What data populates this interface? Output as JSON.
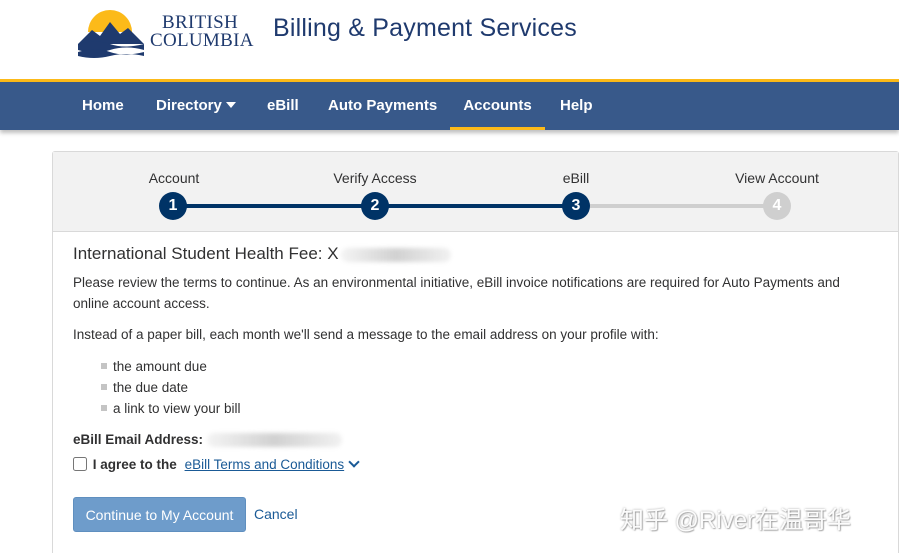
{
  "header": {
    "logo_line1": "BRITISH",
    "logo_line2": "COLUMBIA",
    "title": "Billing & Payment Services"
  },
  "nav": {
    "items": [
      {
        "label": "Home"
      },
      {
        "label": "Directory"
      },
      {
        "label": "eBill"
      },
      {
        "label": "Auto Payments"
      },
      {
        "label": "Accounts"
      },
      {
        "label": "Help"
      }
    ],
    "active": "Accounts"
  },
  "stepper": {
    "steps": [
      {
        "label": "Account",
        "number": "1",
        "state": "complete"
      },
      {
        "label": "Verify Access",
        "number": "2",
        "state": "complete"
      },
      {
        "label": "eBill",
        "number": "3",
        "state": "current"
      },
      {
        "label": "View Account",
        "number": "4",
        "state": "upcoming"
      }
    ]
  },
  "content": {
    "fee_title": "International Student Health Fee: X",
    "intro": "Please review the terms to continue. As an environmental initiative, eBill invoice notifications are required for Auto Payments and online account access.",
    "paper_bill": "Instead of a paper bill, each month we'll send a message to the email address on your profile with:",
    "bullets": [
      "the amount due",
      "the due date",
      "a link to view your bill"
    ],
    "email_label": "eBill Email Address:",
    "agree_text": "I agree to the",
    "terms_link": "eBill Terms and Conditions",
    "continue_button": "Continue to My Account",
    "cancel_link": "Cancel"
  },
  "watermark": "知乎 @River在温哥华",
  "colors": {
    "navy": "#1f3a6e",
    "nav_bg": "#38598a",
    "gold": "#fcba19",
    "step_active": "#003366",
    "step_inactive": "#cfcfcf",
    "button": "#6e9ccb",
    "link": "#1a5a96"
  }
}
